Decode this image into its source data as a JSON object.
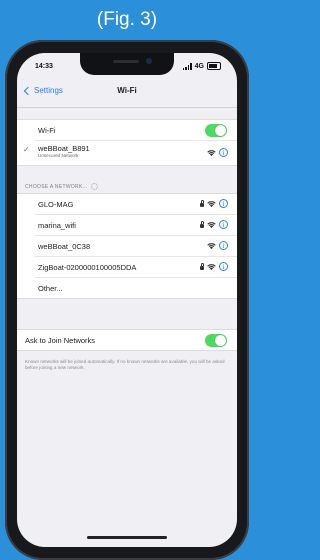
{
  "figure_label": "(Fig. 3)",
  "status_bar": {
    "time": "14:33",
    "network": "4G"
  },
  "nav": {
    "back_label": "Settings",
    "title": "Wi-Fi"
  },
  "wifi_toggle": {
    "label": "Wi-Fi",
    "on": true
  },
  "connected": {
    "name": "weBBoat_B891",
    "sub": "Unsecured Network"
  },
  "section_header": "CHOOSE A NETWORK...",
  "networks": [
    {
      "name": "GLO-MAG",
      "locked": true
    },
    {
      "name": "marina_wifi",
      "locked": true
    },
    {
      "name": "weBBoat_0C38",
      "locked": false
    },
    {
      "name": "ZigBoat-0200000100005DDA",
      "locked": true
    }
  ],
  "other_label": "Other...",
  "ask_join": {
    "label": "Ask to Join Networks",
    "on": true
  },
  "footer": "Known networks will be joined automatically. If no known networks are available, you will be asked before joining a new network.",
  "icons": {
    "info": "info-icon",
    "wifi": "wifi-icon",
    "lock": "lock-icon",
    "back": "chevron-left-icon",
    "check": "checkmark-icon"
  },
  "colors": {
    "accent": "#2d7df6",
    "toggle_on": "#4cd964",
    "page_bg": "#2c8fd9"
  }
}
